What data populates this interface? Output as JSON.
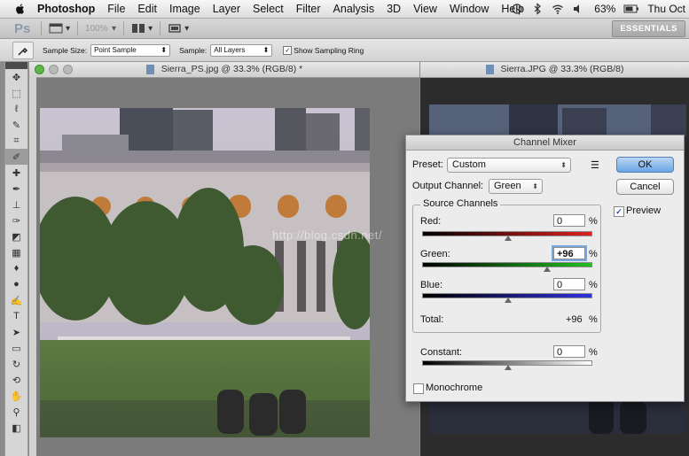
{
  "menubar": {
    "app": "Photoshop",
    "items": [
      "File",
      "Edit",
      "Image",
      "Layer",
      "Select",
      "Filter",
      "Analysis",
      "3D",
      "View",
      "Window",
      "Help"
    ],
    "battery": "63%",
    "clock": "Thu Oct"
  },
  "appbar": {
    "logo": "Ps",
    "zoom": "100%",
    "workspace": "ESSENTIALS"
  },
  "options": {
    "sample_size_label": "Sample Size:",
    "sample_size_value": "Point Sample",
    "sample_label": "Sample:",
    "sample_value": "All Layers",
    "show_ring_label": "Show Sampling Ring",
    "show_ring_checked": true
  },
  "documents": [
    {
      "title": "Sierra_PS.jpg @ 33.3% (RGB/8) *"
    },
    {
      "title": "Sierra.JPG @ 33.3% (RGB/8)"
    }
  ],
  "channel_mixer": {
    "title": "Channel Mixer",
    "preset_label": "Preset:",
    "preset_value": "Custom",
    "output_label": "Output Channel:",
    "output_value": "Green",
    "ok": "OK",
    "cancel": "Cancel",
    "preview_label": "Preview",
    "preview_checked": true,
    "source_title": "Source Channels",
    "red_label": "Red:",
    "red_value": "0",
    "green_label": "Green:",
    "green_value": "+96",
    "blue_label": "Blue:",
    "blue_value": "0",
    "percent": "%",
    "total_label": "Total:",
    "total_value": "+96",
    "constant_label": "Constant:",
    "constant_value": "0",
    "monochrome_label": "Monochrome",
    "monochrome_checked": false
  },
  "watermark": "http://blog.csdn.net/"
}
